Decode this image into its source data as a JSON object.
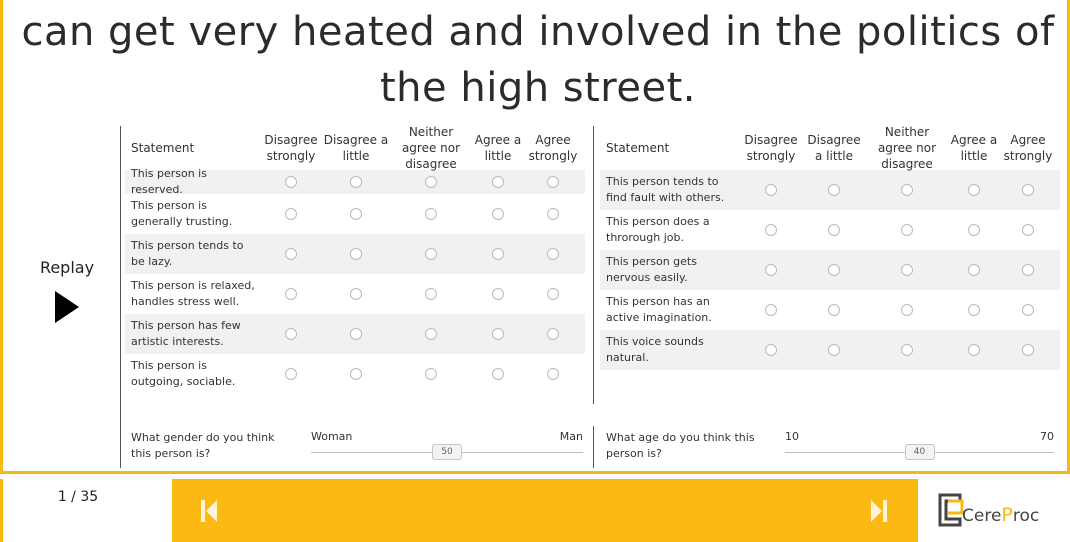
{
  "sentence": "can get very heated and involved in the politics of the high street.",
  "replay": {
    "label": "Replay"
  },
  "left_grid": {
    "headers": [
      "Statement",
      "Disagree strongly",
      "Disagree a little",
      "Neither agree nor disagree",
      "Agree a little",
      "Agree strongly"
    ],
    "rows": [
      "This person is reserved.",
      "This person is generally trusting.",
      "This person tends to be lazy.",
      "This person is relaxed, handles stress well.",
      "This person has few artistic interests.",
      "This person is outgoing, sociable."
    ]
  },
  "right_grid": {
    "headers": [
      "Statement",
      "Disagree strongly",
      "Disagree a little",
      "Neither agree nor disagree",
      "Agree a little",
      "Agree strongly"
    ],
    "rows": [
      "This person tends to find fault with others.",
      "This person does a throrough job.",
      "This person gets nervous easily.",
      "This person has an active imagination.",
      "This voice sounds natural."
    ]
  },
  "gender_slider": {
    "question": "What gender do you think this person is?",
    "min_label": "Woman",
    "max_label": "Man",
    "value": "50",
    "fraction": 0.5
  },
  "age_slider": {
    "question": "What age do you think this person is?",
    "min_label": "10",
    "max_label": "70",
    "value": "40",
    "fraction": 0.5
  },
  "footer": {
    "page_counter": "1 / 35",
    "logo_cere": "Cere",
    "logo_proc_p": "P",
    "logo_proc_rest": "roc"
  },
  "colors": {
    "accent": "#fcb813",
    "frame": "#f5b913"
  },
  "icons": {
    "first": "skip-to-first-icon",
    "last": "skip-to-last-icon",
    "play": "play-icon"
  }
}
